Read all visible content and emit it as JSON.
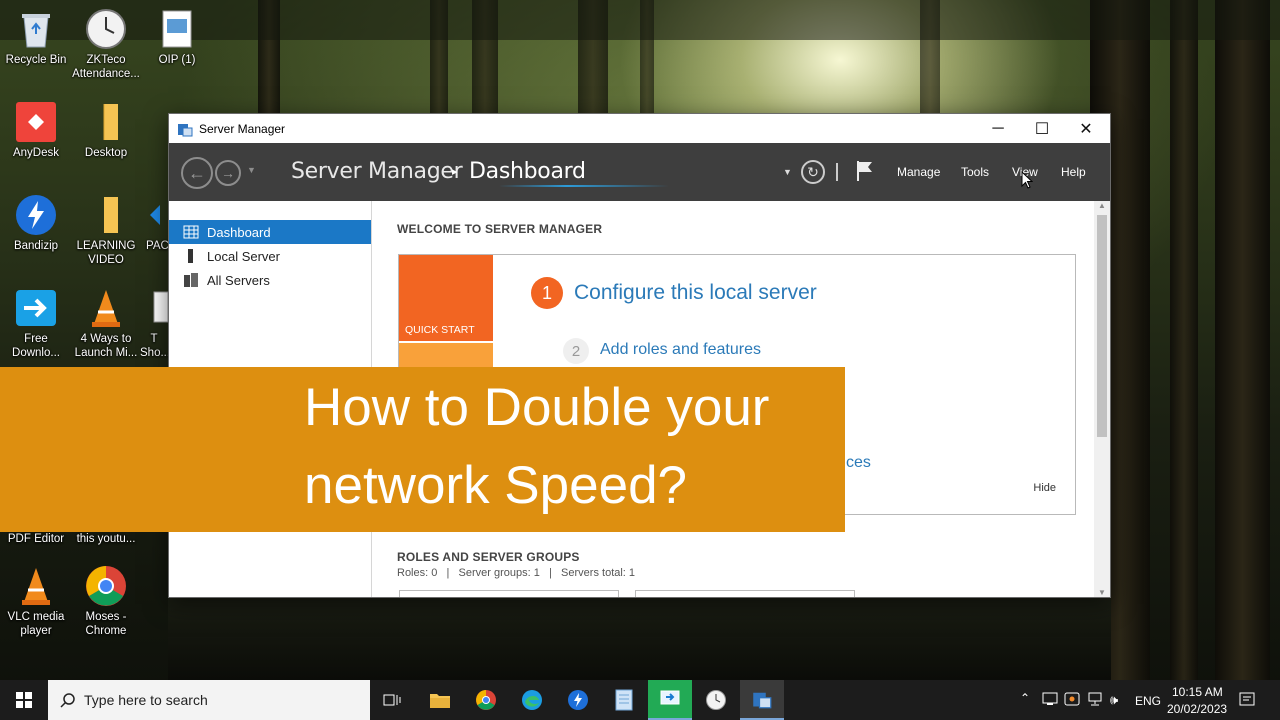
{
  "desktop": {
    "icons": [
      {
        "label": "Recycle Bin"
      },
      {
        "label": "ZKTeco Attendance..."
      },
      {
        "label": "OIP (1)"
      },
      {
        "label": "AnyDesk"
      },
      {
        "label": "Desktop"
      },
      {
        "label": "Bandizip"
      },
      {
        "label": "LEARNING VIDEO"
      },
      {
        "label": "PACT"
      },
      {
        "label": "Free Downlo..."
      },
      {
        "label": "4 Ways to Launch Mi..."
      },
      {
        "label": "T Sho..."
      },
      {
        "label": "PDF Editor"
      },
      {
        "label": "this youtu..."
      },
      {
        "label": "VLC media player"
      },
      {
        "label": "Moses - Chrome"
      }
    ]
  },
  "window": {
    "title": "Server Manager",
    "controls": {
      "minimize": "─",
      "maximize": "☐",
      "close": "✕"
    },
    "header": {
      "breadcrumb_root": "Server Manager",
      "breadcrumb_separator": "▸",
      "breadcrumb_current": "Dashboard",
      "menus": [
        "Manage",
        "Tools",
        "View",
        "Help"
      ]
    },
    "sidebar": {
      "items": [
        {
          "label": "Dashboard",
          "icon": "dashboard-grid-icon",
          "active": true
        },
        {
          "label": "Local Server",
          "icon": "server-icon",
          "active": false
        },
        {
          "label": "All Servers",
          "icon": "servers-icon",
          "active": false
        }
      ]
    },
    "main": {
      "welcome_title": "WELCOME TO SERVER MANAGER",
      "quick_start_label": "QUICK START",
      "step1_number": "1",
      "step1_label": "Configure this local server",
      "step2_number": "2",
      "step2_label": "Add roles and features",
      "step_partial": "ces",
      "hide_label": "Hide",
      "roles_title": "ROLES AND SERVER GROUPS",
      "roles_summary": "Roles: 0   |   Server groups: 1   |   Servers total: 1"
    }
  },
  "banner": {
    "line1": "How to Double your",
    "line2": "network Speed?",
    "color": "#dd8f10"
  },
  "taskbar": {
    "search_placeholder": "Type here to search",
    "language": "ENG",
    "time": "10:15 AM",
    "date": "20/02/2023"
  },
  "colors": {
    "accent_blue": "#1b78c6",
    "header_dark": "#3e3e3e",
    "quick_start_orange": "#f26522",
    "link_blue": "#2b7ab8"
  }
}
